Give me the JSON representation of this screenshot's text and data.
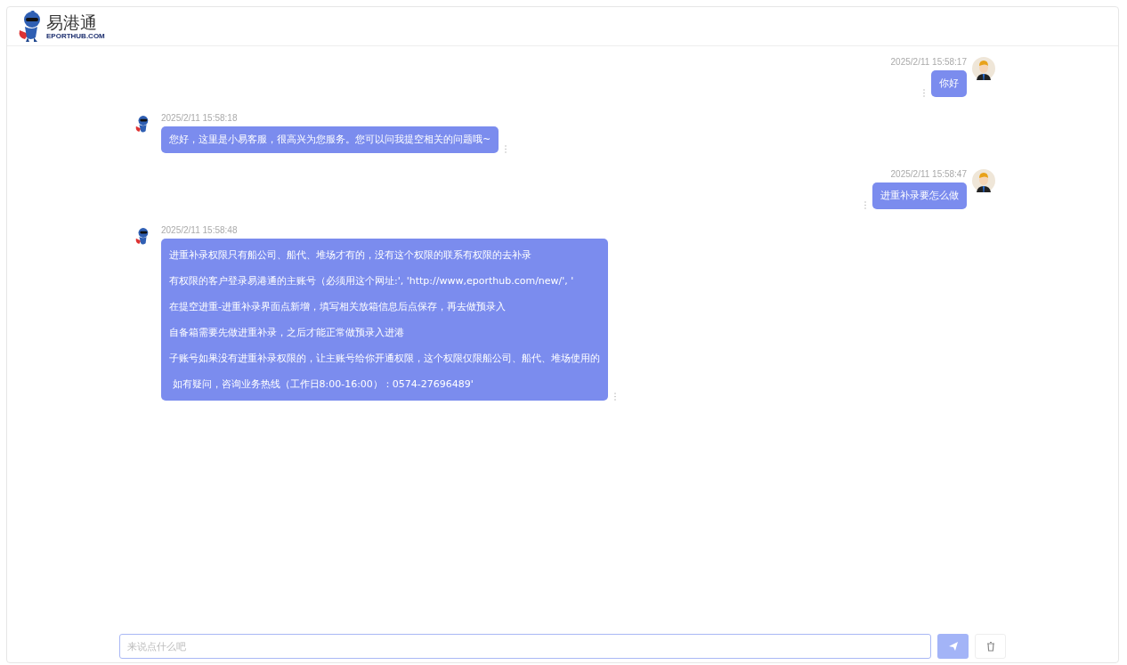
{
  "header": {
    "logo_text": "易港通",
    "logo_subtext": "EPORTHUB.COM"
  },
  "messages": [
    {
      "kind": "user",
      "time": "2025/2/11 15:58:17",
      "lines": [
        "你好"
      ]
    },
    {
      "kind": "bot",
      "time": "2025/2/11 15:58:18",
      "lines": [
        "您好，这里是小易客服，很高兴为您服务。您可以问我提空相关的问题哦~"
      ]
    },
    {
      "kind": "user",
      "time": "2025/2/11 15:58:47",
      "lines": [
        "进重补录要怎么做"
      ]
    },
    {
      "kind": "bot",
      "time": "2025/2/11 15:58:48",
      "lines": [
        "进重补录权限只有船公司、船代、堆场才有的，没有这个权限的联系有权限的去补录",
        "有权限的客户登录易港通的主账号（必须用这个网址:', 'http://www,eporthub.com/new/', '",
        "在提空进重-进重补录界面点新增，填写相关放箱信息后点保存，再去做预录入",
        "自备箱需要先做进重补录，之后才能正常做预录入进港",
        "子账号如果没有进重补录权限的，让主账号给你开通权限，这个权限仅限船公司、船代、堆场使用的",
        " 如有疑问，咨询业务热线（工作日8:00-16:00）：0574-27696489'"
      ]
    }
  ],
  "input": {
    "placeholder": "来说点什么吧"
  }
}
